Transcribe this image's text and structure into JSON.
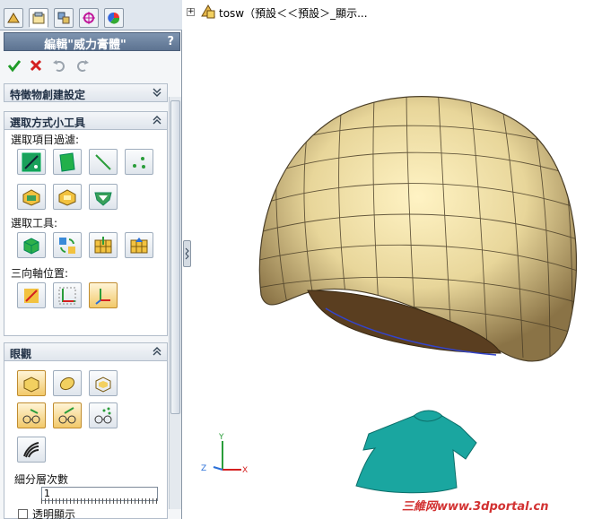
{
  "panel": {
    "title": "編輯\"威力膏體\"",
    "help": "?",
    "sections": {
      "feature_settings": "特徵物創建設定",
      "selection_tools": "選取方式小工具",
      "display": "眼觀"
    },
    "selection_filter_label": "選取項目過濾:",
    "selection_tools_label": "選取工具:",
    "triad_label": "三向軸位置:",
    "subdivision_label": "細分層次數",
    "subdivision_value": "1",
    "transparent_label": "透明顯示"
  },
  "tree": {
    "expand": "+",
    "text": "tosw（預設＜＜預設＞_顯示..."
  },
  "triad": {
    "x": "X",
    "y": "Y",
    "z": "Z"
  },
  "watermark": "三維网www.3dportal.cn",
  "colors": {
    "accent": "#f2c96a",
    "body_fill": "#e8d69a",
    "shirt": "#1aa6a0",
    "ok": "#1f9b27",
    "cancel": "#d42020"
  },
  "icons": {
    "tabs": [
      "feature-tree-icon",
      "property-manager-icon",
      "configuration-manager-icon",
      "dimxpert-icon",
      "display-manager-icon"
    ],
    "actions": [
      "ok-check-icon",
      "cancel-x-icon",
      "undo-icon",
      "redo-icon"
    ]
  }
}
